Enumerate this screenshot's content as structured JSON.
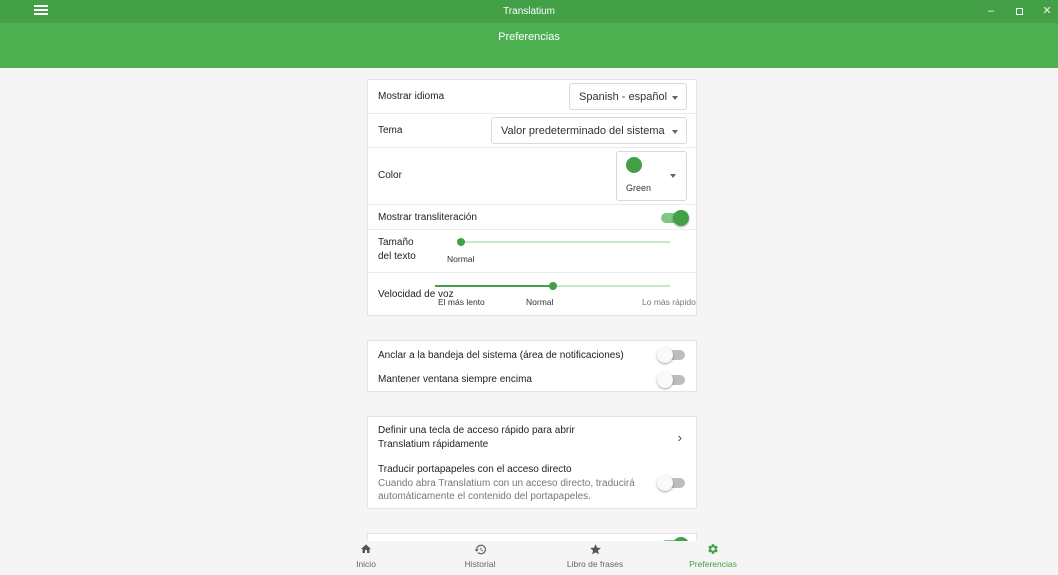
{
  "window": {
    "title": "Translatium",
    "minimize_glyph": "–",
    "close_glyph": "✕"
  },
  "appbar": {
    "title": "Preferencias"
  },
  "accent_color": "#43a047",
  "general": {
    "language_label": "Mostrar idioma",
    "language_value": "Spanish - español",
    "theme_label": "Tema",
    "theme_value": "Valor predeterminado del sistema",
    "color_label": "Color",
    "color_value": "Green",
    "color_hex": "#43a047",
    "transliteration_label": "Mostrar transliteración",
    "transliteration_on": true,
    "text_size_label": "Tamaño del texto",
    "text_size_value": "Normal",
    "text_size_level": 0.0,
    "voice_speed_label": "Velocidad de voz",
    "voice_speed_min": "El más lento",
    "voice_speed_mid": "Normal",
    "voice_speed_max": "Lo más rápido",
    "voice_speed_level": 0.5
  },
  "system": {
    "tray_label": "Anclar a la bandeja del sistema (área de notificaciones)",
    "tray_on": false,
    "always_on_top_label": "Mantener ventana siempre encima",
    "always_on_top_on": false
  },
  "shortcut": {
    "hotkey_label": "Definir una tecla de acceso rápido para abrir Translatium rápidamente",
    "clipboard_title": "Traducir portapapeles con el acceso directo",
    "clipboard_desc": "Cuando abra Translatium con un acceso directo, traducirá automáticamente el contenido del portapapeles.",
    "clipboard_on": false
  },
  "nav": {
    "items": [
      {
        "label": "Inicio",
        "icon": "home-icon",
        "active": false
      },
      {
        "label": "Historial",
        "icon": "history-icon",
        "active": false
      },
      {
        "label": "Libro de frases",
        "icon": "star-icon",
        "active": false
      },
      {
        "label": "Preferencias",
        "icon": "gear-icon",
        "active": true
      }
    ]
  }
}
